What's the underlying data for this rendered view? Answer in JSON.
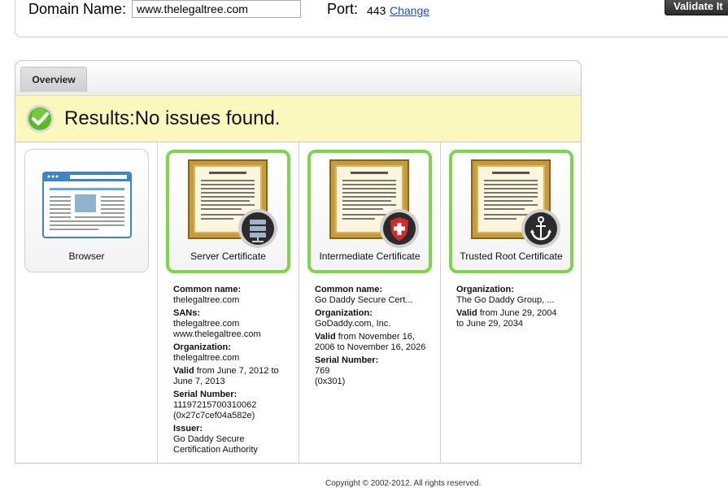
{
  "header": {
    "domain_label": "Domain Name:",
    "domain_value": "www.thelegaltree.com",
    "port_label": "Port:",
    "port_value": "443",
    "port_change": "Change",
    "validate_label": "Validate It"
  },
  "tabs": [
    {
      "label": "Overview"
    }
  ],
  "result": {
    "text": "Results:No issues found."
  },
  "chain": [
    {
      "label": "Browser",
      "icon": "browser-icon"
    },
    {
      "label": "Server Certificate",
      "icon": "server-badge-icon",
      "details": [
        {
          "key": "Common name:",
          "lines": [
            "thelegaltree.com"
          ]
        },
        {
          "key": "SANs:",
          "lines": [
            "thelegaltree.com",
            "www.thelegaltree.com"
          ]
        },
        {
          "key": "Organization:",
          "lines": [
            "thelegaltree.com"
          ]
        },
        {
          "key": "Valid",
          "inline": " from June 7, 2012 to June 7, 2013"
        },
        {
          "key": "Serial Number:",
          "lines": [
            "11197215700310062",
            "(0x27c7cef04a582e)"
          ]
        },
        {
          "key": "Issuer:",
          "lines": [
            "Go Daddy Secure",
            "Certification Authority"
          ]
        }
      ]
    },
    {
      "label": "Intermediate Certificate",
      "icon": "shield-badge-icon",
      "details": [
        {
          "key": "Common name:",
          "lines": [
            "Go Daddy Secure Cert..."
          ]
        },
        {
          "key": "Organization:",
          "lines": [
            "GoDaddy.com, Inc."
          ]
        },
        {
          "key": "Valid",
          "inline": " from November 16, 2006 to November 16, 2026"
        },
        {
          "key": "Serial Number:",
          "lines": [
            "769",
            "(0x301)"
          ]
        }
      ]
    },
    {
      "label": "Trusted Root Certificate",
      "icon": "anchor-badge-icon",
      "details": [
        {
          "key": "Organization:",
          "lines": [
            "The Go Daddy Group, ..."
          ]
        },
        {
          "key": "Valid",
          "inline": " from June 29, 2004 to June 29, 2034"
        }
      ]
    }
  ],
  "colors": {
    "success_green": "#7fd44a",
    "result_bg": "#fbf7bd",
    "link": "#1a4fd6"
  },
  "footer": "Copyright © 2002-2012. All rights reserved."
}
